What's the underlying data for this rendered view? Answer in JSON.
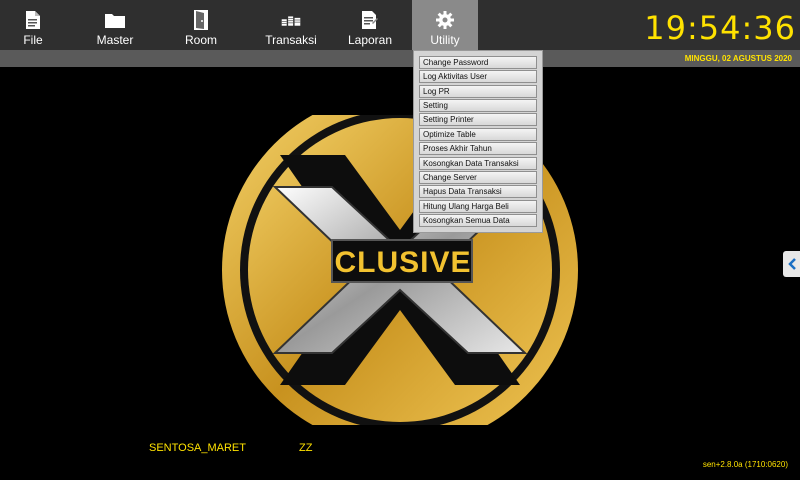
{
  "toolbar": {
    "items": [
      {
        "label": "File",
        "icon": "file-icon"
      },
      {
        "label": "Master",
        "icon": "folder-icon"
      },
      {
        "label": "Room",
        "icon": "door-icon"
      },
      {
        "label": "Transaksi",
        "icon": "coins-icon"
      },
      {
        "label": "Laporan",
        "icon": "report-icon"
      },
      {
        "label": "Utility",
        "icon": "gear-icon"
      }
    ],
    "active": "Utility"
  },
  "clock": {
    "time": "19:54:36",
    "date": "MINGGU, 02 AGUSTUS 2020"
  },
  "utility_menu": {
    "items": [
      "Change Password",
      "Log Aktivitas User",
      "Log PR",
      "Setting",
      "Setting Printer",
      "Optimize Table",
      "Proses Akhir Tahun",
      "Kosongkan Data Transaksi",
      "Change Server",
      "Hapus Data Transaksi",
      "Hitung Ulang Harga Beli",
      "Kosongkan Semua Data"
    ]
  },
  "logo": {
    "text": "CLUSIVE"
  },
  "footer": {
    "company": "SENTOSA_MARET",
    "code": "ZZ",
    "version": "sen+2.8.0a (1710:0620)"
  },
  "colors": {
    "accent": "#ffe200",
    "toolbar": "#2f2f2f",
    "active_tab": "#8a8a8a",
    "gold": "#d9a72a"
  }
}
